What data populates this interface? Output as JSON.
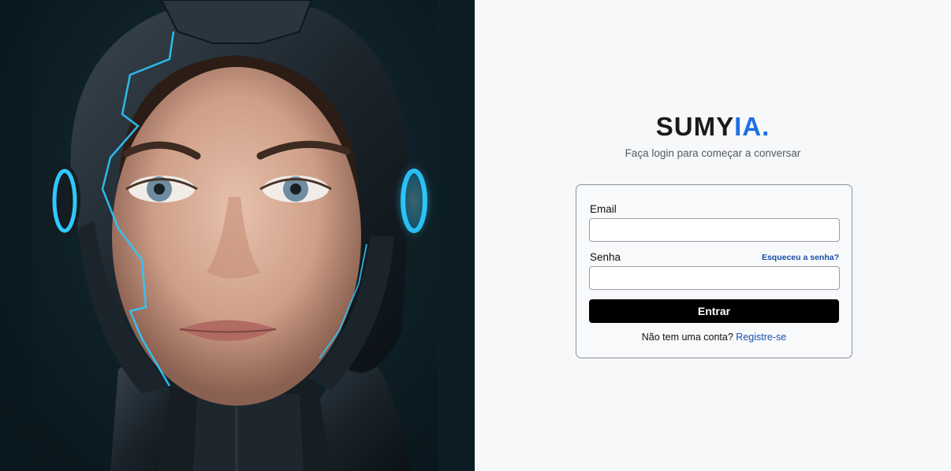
{
  "hero": {
    "image": "cyborg-woman-portrait",
    "accent_glow": "#2ec9ff"
  },
  "brand": {
    "name_main": "SUMY",
    "name_accent": "IA.",
    "accent_color": "#1f6fe5"
  },
  "subtitle": "Faça login para começar a conversar",
  "form": {
    "email_label": "Email",
    "email_value": "",
    "password_label": "Senha",
    "password_value": "",
    "forgot_link": "Esqueceu a senha?",
    "submit_label": "Entrar",
    "no_account_text": "Não tem uma conta?",
    "register_link": "Registre-se"
  }
}
